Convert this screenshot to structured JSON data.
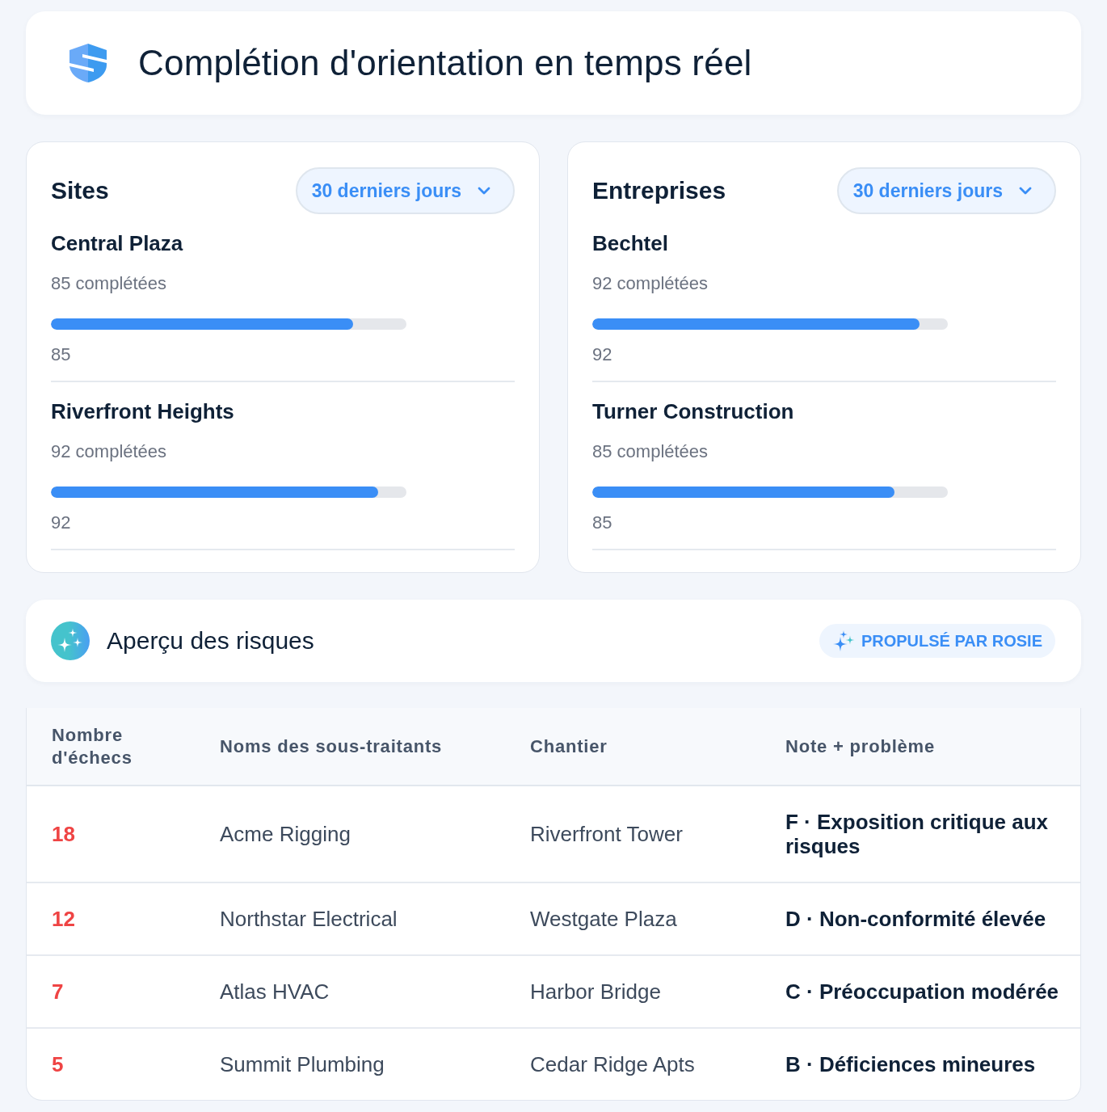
{
  "header": {
    "title": "Complétion d'orientation en temps réel"
  },
  "panels": [
    {
      "title": "Sites",
      "filter": "30 derniers jours",
      "items": [
        {
          "name": "Central Plaza",
          "completed": "85 complétées",
          "level": 0.85,
          "value": "85"
        },
        {
          "name": "Riverfront Heights",
          "completed": "92 complétées",
          "level": 0.92,
          "value": "92"
        }
      ]
    },
    {
      "title": "Entreprises",
      "filter": "30 derniers jours",
      "items": [
        {
          "name": "Bechtel",
          "completed": "92 complétées",
          "level": 0.92,
          "value": "92"
        },
        {
          "name": "Turner Construction",
          "completed": "85 complétées",
          "level": 0.85,
          "value": "85"
        }
      ]
    }
  ],
  "risk_overview": {
    "title": "Aperçu des risques",
    "badge": "PROPULSÉ PAR ROSIE"
  },
  "table": {
    "columns": [
      "Nombre d'échecs",
      "Noms des sous-traitants",
      "Chantier",
      "Note + problème"
    ],
    "rows": [
      {
        "failures": "18",
        "subcontractor": "Acme Rigging",
        "site": "Riverfront Tower",
        "rating": "F · Exposition critique aux risques"
      },
      {
        "failures": "12",
        "subcontractor": "Northstar Electrical",
        "site": "Westgate Plaza",
        "rating": "D · Non-conformité élevée"
      },
      {
        "failures": "7",
        "subcontractor": "Atlas HVAC",
        "site": "Harbor Bridge",
        "rating": "C · Préoccupation modérée"
      },
      {
        "failures": "5",
        "subcontractor": "Summit Plumbing",
        "site": "Cedar Ridge Apts",
        "rating": "B · Déficiences mineures"
      }
    ]
  }
}
